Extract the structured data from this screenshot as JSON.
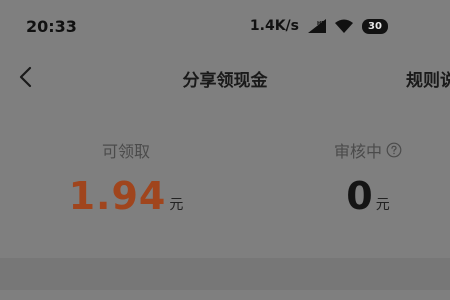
{
  "status_bar": {
    "time": "20:33",
    "net_speed": "1.4K/s",
    "battery": "30"
  },
  "nav": {
    "title": "分享领现金",
    "rules": "规则说明"
  },
  "balances": {
    "claimable_label": "可领取",
    "claimable_amount": "1.94",
    "claimable_unit": "元",
    "reviewing_label": "审核中",
    "reviewing_amount": "0",
    "reviewing_unit": "元"
  },
  "colors": {
    "background": "#7f7f7f",
    "amount_accent": "#a0451d"
  },
  "icons": [
    "back-arrow-icon",
    "signal-icon",
    "wifi-icon",
    "help-icon"
  ]
}
